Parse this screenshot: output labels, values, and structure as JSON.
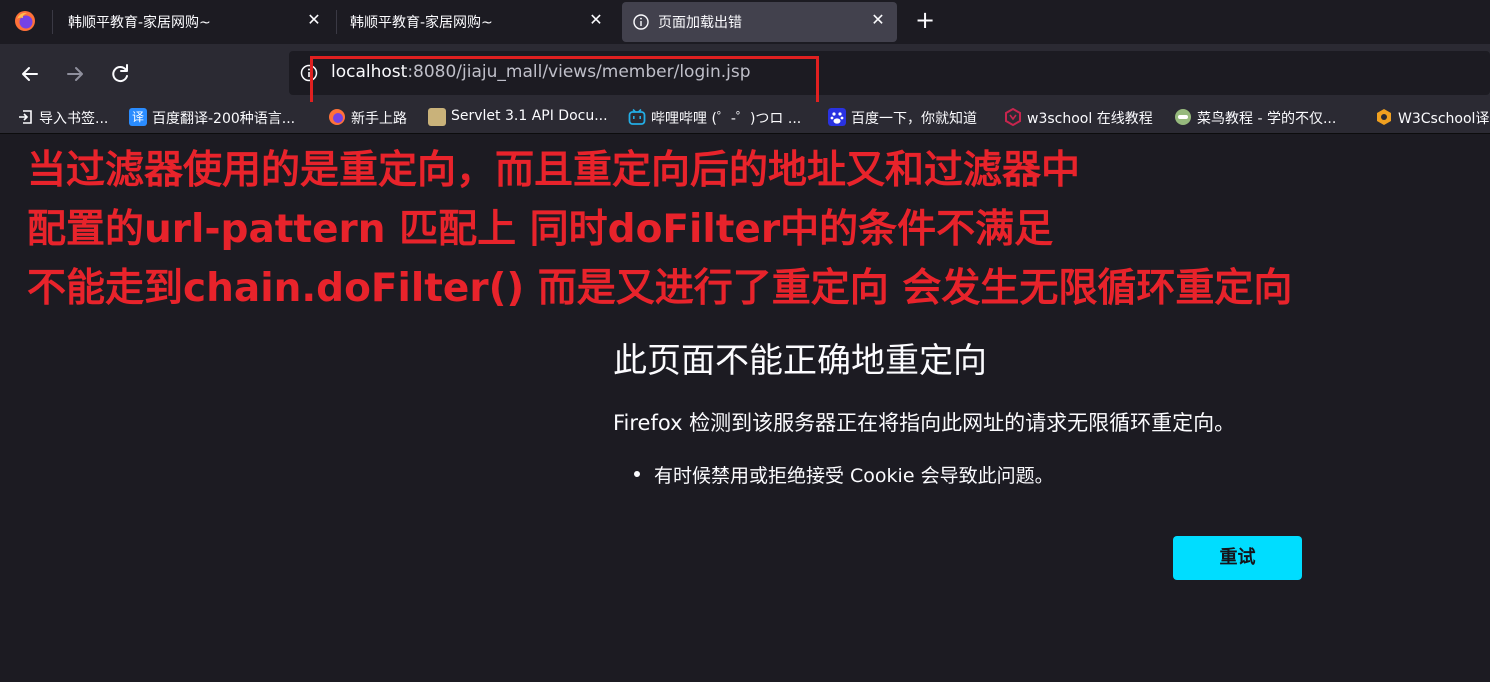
{
  "tabs": [
    {
      "title": "韩顺平教育-家居网购~",
      "close": "✕"
    },
    {
      "title": "韩顺平教育-家居网购~",
      "close": "✕"
    },
    {
      "title": "页面加载出错",
      "close": "✕",
      "active": true
    }
  ],
  "new_tab": "+",
  "url": {
    "host": "localhost",
    "rest": ":8080/jiaju_mall/views/member/login.jsp"
  },
  "bookmarks": [
    {
      "label": "导入书签...",
      "icon": "import-icon",
      "color": "#fbfbfe"
    },
    {
      "label": "百度翻译-200种语言...",
      "icon": "baidu-translate-icon",
      "color": "#2a8cff"
    },
    {
      "label": "新手上路",
      "icon": "firefox-icon",
      "color": "#ff7139"
    },
    {
      "label": "Servlet 3.1 API Docu...",
      "icon": "servlet-icon",
      "color": "#c9b27a"
    },
    {
      "label": "哔哩哔哩 (゜-゜)つロ ...",
      "icon": "bilibili-icon",
      "color": "#23ade5"
    },
    {
      "label": "百度一下，你就知道",
      "icon": "baidu-icon",
      "color": "#2932e1"
    },
    {
      "label": "w3school 在线教程",
      "icon": "w3school-icon",
      "color": "#c7254e"
    },
    {
      "label": "菜鸟教程 - 学的不仅...",
      "icon": "runoob-icon",
      "color": "#96b97d"
    },
    {
      "label": "W3Cschool译",
      "icon": "w3cschool-icon",
      "color": "#f0a020"
    }
  ],
  "annotation": {
    "lines": [
      "当过滤器使用的是重定向，而且重定向后的地址又和过滤器中",
      "配置的url-pattern 匹配上 同时doFilter中的条件不满足",
      "不能走到chain.doFilter() 而是又进行了重定向 会发生无限循环重定向"
    ],
    "color": "#e8232b"
  },
  "error": {
    "title": "此页面不能正确地重定向",
    "description": "Firefox 检测到该服务器正在将指向此网址的请求无限循环重定向。",
    "bullets": [
      "有时候禁用或拒绝接受 Cookie 会导致此问题。"
    ],
    "retry_label": "重试"
  },
  "colors": {
    "accent": "#00ddff",
    "highlight": "#e02020",
    "background": "#1c1b22"
  }
}
